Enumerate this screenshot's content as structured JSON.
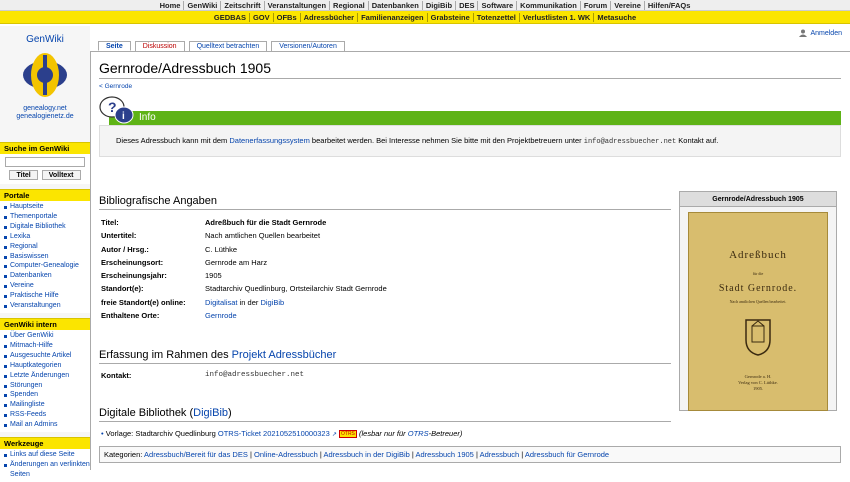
{
  "topnav": [
    "Home",
    "GenWiki",
    "Zeitschrift",
    "Veranstaltungen",
    "Regional",
    "Datenbanken",
    "DigiBib",
    "DES",
    "Software",
    "Kommunikation",
    "Forum",
    "Vereine",
    "Hilfen/FAQs"
  ],
  "subnav": [
    "GEDBAS",
    "GOV",
    "OFBs",
    "Adressbücher",
    "Familienanzeigen",
    "Grabsteine",
    "Totenzettel",
    "Verlustlisten 1. WK",
    "Metasuche"
  ],
  "sidebar": {
    "site_name": "GenWiki",
    "url1": "genealogy.net",
    "url2": "genealogienetz.de",
    "search_title": "Suche im GenWiki",
    "search_btn1": "Titel",
    "search_btn2": "Volltext",
    "portale_title": "Portale",
    "portale": [
      "Hauptseite",
      "Themenportale",
      "Digitale Bibliothek",
      "Lexika",
      "Regional",
      "Basiswissen",
      "Computer-Genealogie",
      "Datenbanken",
      "Vereine",
      "Praktische Hilfe",
      "Veranstaltungen"
    ],
    "intern_title": "GenWiki intern",
    "intern": [
      "Über GenWiki",
      "Mitmach-Hilfe",
      "Ausgesuchte Artikel",
      "Hauptkategorien",
      "Letzte Änderungen",
      "Störungen",
      "Spenden",
      "Mailingliste",
      "RSS-Feeds",
      "Mail an Admins"
    ],
    "tools_title": "Werkzeuge",
    "tools": [
      "Links auf diese Seite",
      "Änderungen an verlinkten Seiten"
    ]
  },
  "login": "Anmelden",
  "tabs": [
    "Seite",
    "Diskussion",
    "Quelltext betrachten",
    "Versionen/Autoren"
  ],
  "page": {
    "title": "Gernrode/Adressbuch 1905",
    "breadcrumb": "< Gernrode",
    "info_heading": "Info",
    "info_text_1": "Dieses Adressbuch kann mit dem ",
    "info_link": "Datenerfassungssystem",
    "info_text_2": " bearbeitet werden. Bei Interesse nehmen Sie bitte mit den Projektbetreuern unter ",
    "info_email": "info@adressbuecher.net",
    "info_text_3": " Kontakt auf.",
    "biblio_heading": "Bibliografische Angaben",
    "biblio": [
      {
        "k": "Titel:",
        "v": "Adreßbuch für die Stadt Gernrode"
      },
      {
        "k": "Untertitel:",
        "v": "Nach amtlichen Quellen bearbeitet"
      },
      {
        "k": "Autor / Hrsg.:",
        "v": "C. Lüthke"
      },
      {
        "k": "Erscheinungsort:",
        "v": "Gernrode am Harz"
      },
      {
        "k": "Erscheinungsjahr:",
        "v": "1905"
      },
      {
        "k": "Standort(e):",
        "v": "Stadtarchiv Quedlinburg, Ortsteilarchiv Stadt Gernrode"
      }
    ],
    "online_key": "freie Standort(e) online:",
    "online_link1": "Digitalisat",
    "online_mid": " in der ",
    "online_link2": "DigiBib",
    "orte_key": "Enthaltene Orte:",
    "orte_val": "Gernrode",
    "erfassung_prefix": "Erfassung im Rahmen des ",
    "erfassung_link": "Projekt Adressbücher",
    "kontakt_key": "Kontakt:",
    "kontakt_val": "info@adressbuecher.net",
    "digibib_prefix": "Digitale Bibliothek (",
    "digibib_link": "DigiBib",
    "digibib_suffix": ")",
    "vorlage_prefix": "Vorlage: Stadtarchiv Quedlinburg ",
    "vorlage_link": "OTRS-Ticket 2021052510000323",
    "vorlage_badge": "OTRS",
    "vorlage_note_1": "(lesbar nur für ",
    "vorlage_note_link": "OTRS",
    "vorlage_note_2": "-Betreuer)",
    "categories_label": "Kategorien:",
    "categories": [
      "Adressbuch/Bereit für das DES",
      "Online-Adressbuch",
      "Adressbuch in der DigiBib",
      "Adressbuch 1905",
      "Adressbuch",
      "Adressbuch für Gernrode"
    ]
  },
  "infobox": {
    "caption": "Gernrode/Adressbuch 1905",
    "cover_title": "Adreßbuch",
    "cover_sub": "für die",
    "cover_city": "Stadt Gernrode.",
    "cover_note": "Nach amtlichen Quellen bearbeitet.",
    "cover_imprint": "Gernrode a. H.",
    "cover_imprint2": "Verlag von C. Lüthke.",
    "cover_year": "1905."
  },
  "colors": {
    "accent_yellow": "#fbe500",
    "info_green": "#5eb316",
    "link": "#0645ad"
  }
}
